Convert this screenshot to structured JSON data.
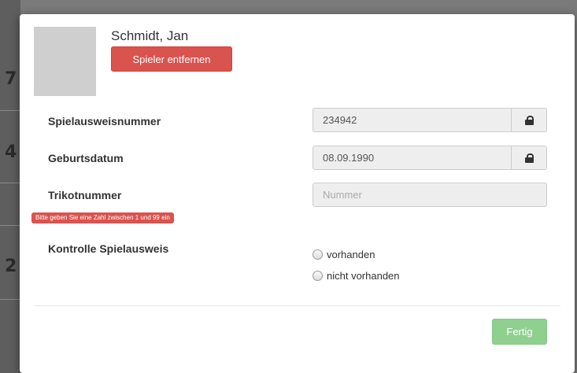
{
  "background": {
    "digits": [
      "7",
      "4",
      "2"
    ]
  },
  "player": {
    "name": "Schmidt, Jan",
    "remove_label": "Spieler entfernen"
  },
  "fields": {
    "pass_number": {
      "label": "Spielausweisnummer",
      "value": "234942",
      "locked": true
    },
    "birth_date": {
      "label": "Geburtsdatum",
      "value": "08.09.1990",
      "locked": true
    },
    "jersey": {
      "label": "Trikotnummer",
      "placeholder": "Nummer",
      "value": ""
    },
    "jersey_error": "Bitte geben Sie eine Zahl zwischen 1 und 99 ein"
  },
  "pass_check": {
    "label": "Kontrolle Spielausweis",
    "options": [
      "vorhanden",
      "nicht vorhanden"
    ]
  },
  "footer": {
    "done_label": "Fertig"
  },
  "colors": {
    "danger": "#d9534f",
    "success_disabled": "#8fd08f",
    "input_readonly_bg": "#eeeeee"
  },
  "icons": {
    "lock": "lock-icon"
  }
}
